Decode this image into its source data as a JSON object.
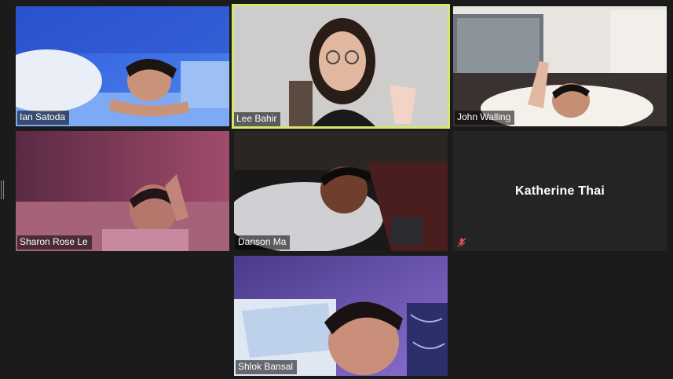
{
  "participants": [
    {
      "name": "Ian Satoda",
      "video": true,
      "active": false
    },
    {
      "name": "Lee Bahir",
      "video": true,
      "active": true
    },
    {
      "name": "John Walling",
      "video": true,
      "active": false
    },
    {
      "name": "Sharon Rose Le",
      "video": true,
      "active": false
    },
    {
      "name": "Danson Ma",
      "video": true,
      "active": false
    },
    {
      "name": "Katherine Thai",
      "video": false,
      "active": false,
      "muted": true
    },
    {
      "name": "Shlok Bansal",
      "video": true,
      "active": false
    }
  ],
  "colors": {
    "background": "#1b1b1b",
    "active_speaker_border": "#d6e86a",
    "muted_icon": "#e04b4b"
  }
}
